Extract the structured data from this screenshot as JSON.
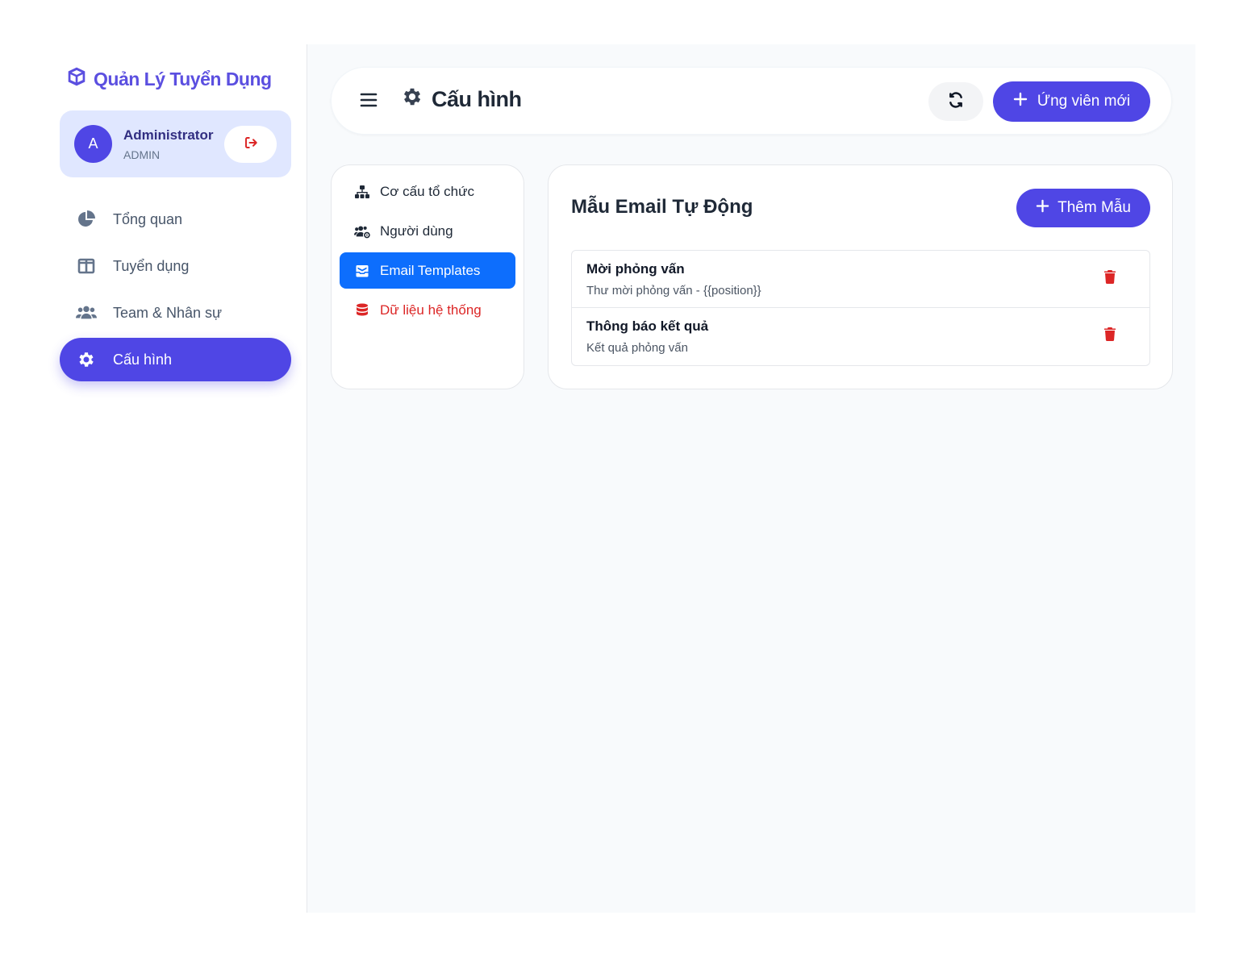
{
  "brand": {
    "name": "Quản Lý Tuyển Dụng",
    "icon": "cube-icon",
    "color": "#5b4fe0"
  },
  "user": {
    "avatar_letter": "A",
    "name": "Administrator",
    "role": "ADMIN",
    "logout_icon": "sign-out-icon"
  },
  "sidebar": {
    "items": [
      {
        "label": "Tổng quan",
        "icon": "pie-chart-icon",
        "active": false
      },
      {
        "label": "Tuyển dụng",
        "icon": "columns-icon",
        "active": false
      },
      {
        "label": "Team & Nhân sự",
        "icon": "users-icon",
        "active": false
      },
      {
        "label": "Cấu hình",
        "icon": "gear-icon",
        "active": true
      }
    ]
  },
  "header": {
    "title": "Cấu hình",
    "title_icon": "gear-icon",
    "refresh_icon": "refresh-icon",
    "new_candidate_label": "Ứng viên mới"
  },
  "settings_nav": {
    "items": [
      {
        "label": "Cơ cấu tổ chức",
        "icon": "sitemap-icon",
        "state": "normal"
      },
      {
        "label": "Người dùng",
        "icon": "users-cog-icon",
        "state": "normal"
      },
      {
        "label": "Email Templates",
        "icon": "envelope-open-icon",
        "state": "active"
      },
      {
        "label": "Dữ liệu hệ thống",
        "icon": "database-icon",
        "state": "danger"
      }
    ]
  },
  "panel": {
    "title": "Mẫu Email Tự Động",
    "add_label": "Thêm Mẫu",
    "templates": [
      {
        "name": "Mời phỏng vấn",
        "subject": "Thư mời phỏng vấn - {{position}}"
      },
      {
        "name": "Thông báo kết quả",
        "subject": "Kết quả phỏng vấn"
      }
    ]
  },
  "colors": {
    "primary": "#4f46e5",
    "active_tab": "#0d6efd",
    "danger": "#dc2626",
    "user_card": "#e0e7ff"
  }
}
